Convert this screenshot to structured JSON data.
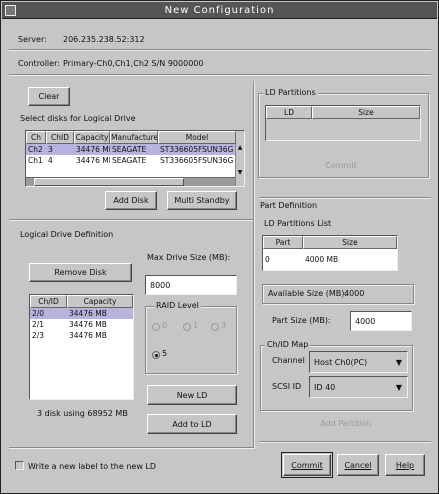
{
  "window": {
    "title": "New Configuration"
  },
  "server": {
    "label": "Server:",
    "value": "206.235.238.52:312"
  },
  "controller": {
    "label": "Controller:",
    "value": "Primary-Ch0,Ch1,Ch2 S/N 9000000"
  },
  "clear_button": "Clear",
  "select_disks": {
    "title": "Select disks for Logical Drive",
    "columns": [
      "Ch",
      "ChID",
      "Capacity",
      "Manufacturer",
      "Model"
    ],
    "rows": [
      [
        "Ch2",
        "3",
        "34476 MB",
        "SEAGATE",
        "ST336605FSUN36G"
      ],
      [
        "Ch1",
        "4",
        "34476 MB",
        "SEAGATE",
        "ST336605FSUN36G"
      ]
    ]
  },
  "add_disk_button": "Add Disk",
  "multi_standby_button": "Multi Standby",
  "ld_partition": {
    "title": "LD Partitions",
    "columns": [
      "LD",
      "Size"
    ],
    "commit_label": "Commit"
  },
  "logical_drive": {
    "title": "Logical Drive Definition",
    "remove_disk_button": "Remove Disk",
    "columns": [
      "Ch/ID",
      "Capacity"
    ],
    "rows": [
      [
        "2/0",
        "34476 MB"
      ],
      [
        "2/1",
        "34476 MB"
      ],
      [
        "2/3",
        "34476 MB"
      ]
    ],
    "summary": "3 disk using 68952 MB",
    "max_drive_size_label": "Max Drive Size (MB):",
    "max_drive_size_value": "8000",
    "raid_level_label": "RAID Level",
    "raid_options": [
      "0",
      "1",
      "3",
      "5"
    ],
    "raid_selected": "5",
    "new_ld_button": "New LD",
    "add_ld_button": "Add to LD"
  },
  "part_definition": {
    "title": "Part Definition",
    "ld_status": "LD Partitions List",
    "columns": [
      "Part",
      "Size"
    ],
    "rows": [
      [
        "0",
        "4000 MB"
      ]
    ],
    "available_size_label": "Available Size (MB):",
    "available_size_value": "4000",
    "part_size_label": "Part Size (MB):",
    "part_size_value": "4000",
    "map_title": "Ch/ID Map",
    "channel_label": "Channel",
    "channel_value": "Host Ch0(PC)",
    "scsi_id_label": "SCSI ID",
    "scsi_id_value": "ID 40",
    "add_partition_button": "Add Partition"
  },
  "write_label_checkbox": "Write a new label to the new LD",
  "commit_button": "Commit",
  "cancel_button": "Cancel",
  "help_button": "Help"
}
